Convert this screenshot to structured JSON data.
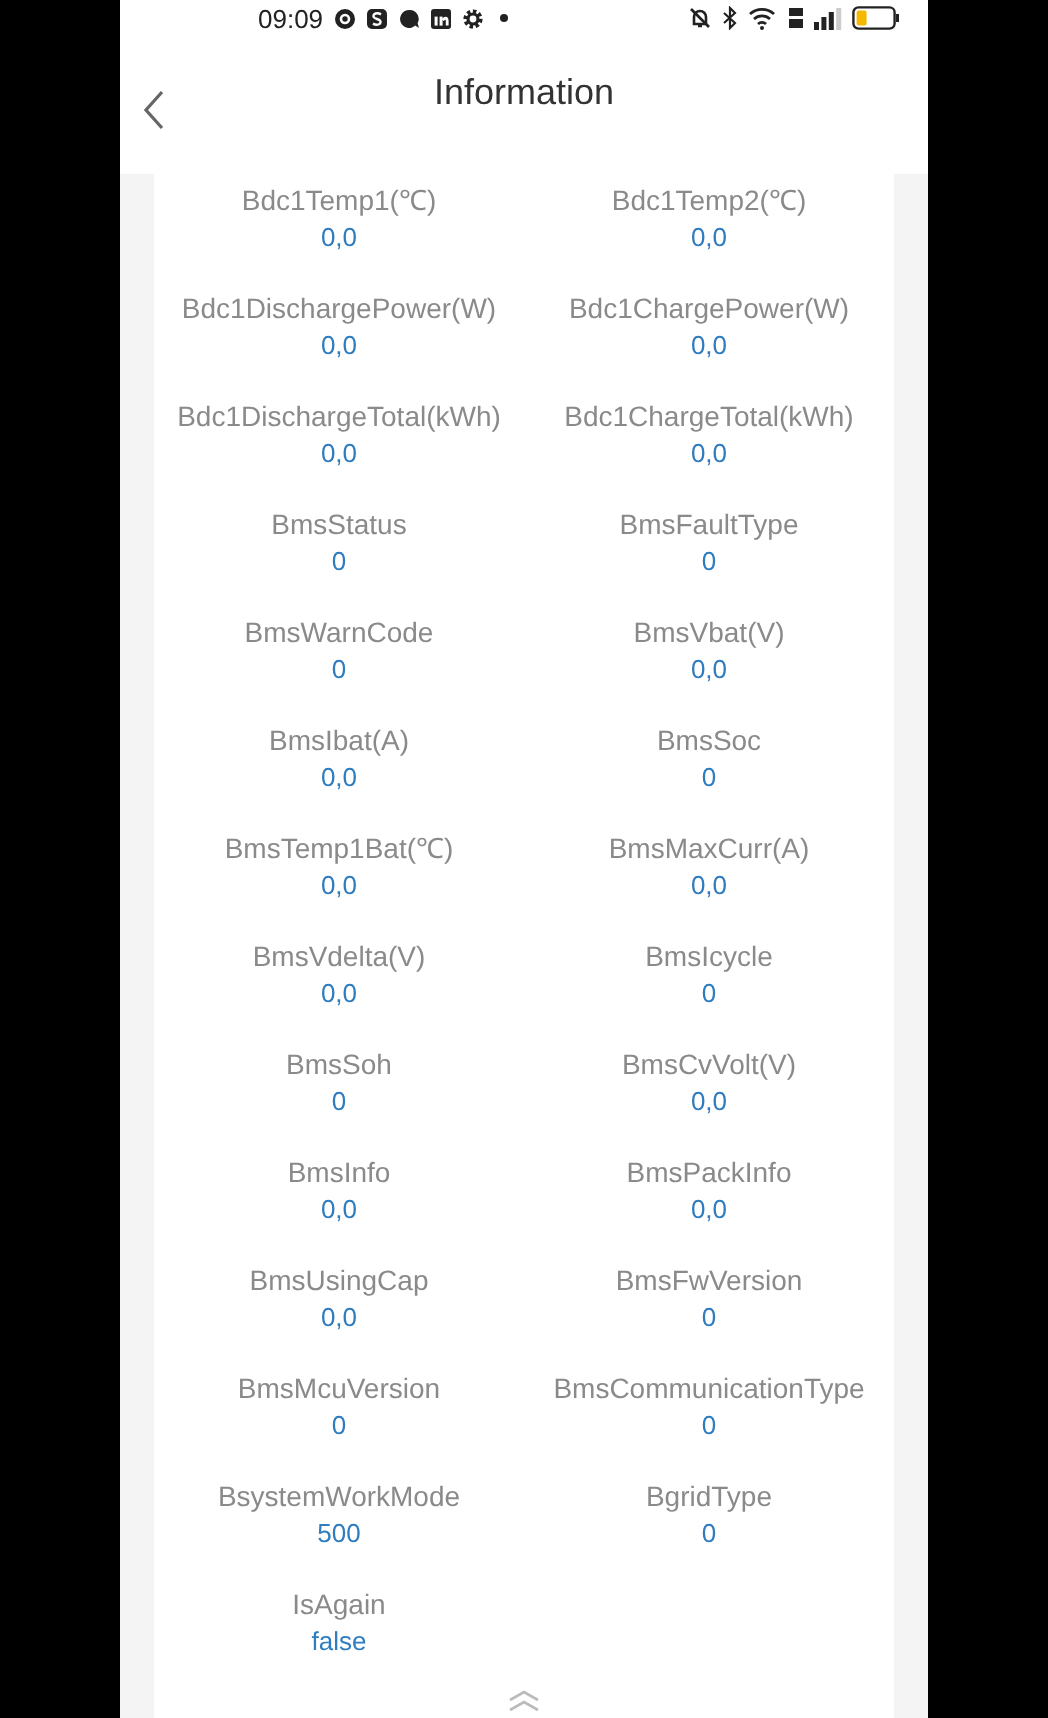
{
  "status_bar": {
    "time": "09:09"
  },
  "header": {
    "title": "Information"
  },
  "fields": [
    {
      "label": "Bdc1Temp1(℃)",
      "value": "0,0"
    },
    {
      "label": "Bdc1Temp2(℃)",
      "value": "0,0"
    },
    {
      "label": "Bdc1DischargePower(W)",
      "value": "0,0"
    },
    {
      "label": "Bdc1ChargePower(W)",
      "value": "0,0"
    },
    {
      "label": "Bdc1DischargeTotal(kWh)",
      "value": "0,0"
    },
    {
      "label": "Bdc1ChargeTotal(kWh)",
      "value": "0,0"
    },
    {
      "label": "BmsStatus",
      "value": "0"
    },
    {
      "label": "BmsFaultType",
      "value": "0"
    },
    {
      "label": "BmsWarnCode",
      "value": "0"
    },
    {
      "label": "BmsVbat(V)",
      "value": "0,0"
    },
    {
      "label": "BmsIbat(A)",
      "value": "0,0"
    },
    {
      "label": "BmsSoc",
      "value": "0"
    },
    {
      "label": "BmsTemp1Bat(℃)",
      "value": "0,0"
    },
    {
      "label": "BmsMaxCurr(A)",
      "value": "0,0"
    },
    {
      "label": "BmsVdelta(V)",
      "value": "0,0"
    },
    {
      "label": "BmsIcycle",
      "value": "0"
    },
    {
      "label": "BmsSoh",
      "value": "0"
    },
    {
      "label": "BmsCvVolt(V)",
      "value": "0,0"
    },
    {
      "label": "BmsInfo",
      "value": "0,0"
    },
    {
      "label": "BmsPackInfo",
      "value": "0,0"
    },
    {
      "label": "BmsUsingCap",
      "value": "0,0"
    },
    {
      "label": "BmsFwVersion",
      "value": "0"
    },
    {
      "label": "BmsMcuVersion",
      "value": "0"
    },
    {
      "label": "BmsCommunicationType",
      "value": "0"
    },
    {
      "label": "BsystemWorkMode",
      "value": "500"
    },
    {
      "label": "BgridType",
      "value": "0"
    },
    {
      "label": "IsAgain",
      "value": "false"
    }
  ]
}
